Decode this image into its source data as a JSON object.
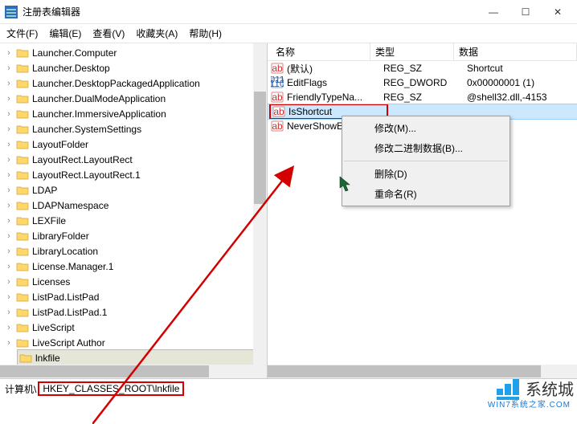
{
  "window": {
    "title": "注册表编辑器"
  },
  "menubar": {
    "file": "文件(F)",
    "edit": "编辑(E)",
    "view": "查看(V)",
    "favorites": "收藏夹(A)",
    "help": "帮助(H)"
  },
  "tree": {
    "items": [
      "Launcher.Computer",
      "Launcher.Desktop",
      "Launcher.DesktopPackagedApplication",
      "Launcher.DualModeApplication",
      "Launcher.ImmersiveApplication",
      "Launcher.SystemSettings",
      "LayoutFolder",
      "LayoutRect.LayoutRect",
      "LayoutRect.LayoutRect.1",
      "LDAP",
      "LDAPNamespace",
      "LEXFile",
      "LibraryFolder",
      "LibraryLocation",
      "License.Manager.1",
      "Licenses",
      "ListPad.ListPad",
      "ListPad.ListPad.1",
      "LiveScript",
      "LiveScript Author"
    ],
    "selected": "lnkfile"
  },
  "columns": {
    "name": "名称",
    "type": "类型",
    "data": "数据"
  },
  "values": [
    {
      "icon": "str",
      "name": "(默认)",
      "type": "REG_SZ",
      "data": "Shortcut"
    },
    {
      "icon": "bin",
      "name": "EditFlags",
      "type": "REG_DWORD",
      "data": "0x00000001 (1)"
    },
    {
      "icon": "str",
      "name": "FriendlyTypeNa...",
      "type": "REG_SZ",
      "data": "@shell32.dll,-4153"
    },
    {
      "icon": "str",
      "name": "IsShortcut",
      "type": "",
      "data": "",
      "selected": true,
      "redbox": true
    },
    {
      "icon": "str",
      "name": "NeverShowE",
      "type": "",
      "data": ""
    }
  ],
  "context_menu": {
    "modify": "修改(M)...",
    "modify_binary": "修改二进制数据(B)...",
    "delete": "删除(D)",
    "rename": "重命名(R)"
  },
  "statusbar": {
    "prefix": "计算机\\",
    "path": "HKEY_CLASSES_ROOT\\lnkfile"
  },
  "watermark": {
    "text": "系统城",
    "sub": "WIN7系统之家.COM"
  }
}
